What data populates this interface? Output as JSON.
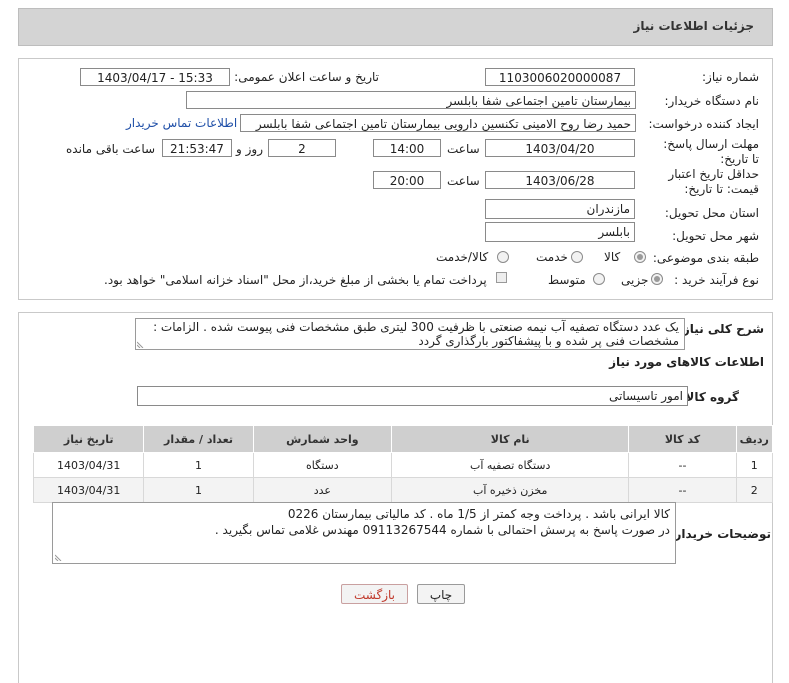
{
  "header": {
    "title": "جزئیات اطلاعات نیاز"
  },
  "form": {
    "need_number_label": "شماره نیاز:",
    "need_number": "1103006020000087",
    "announce_label": "تاریخ و ساعت اعلان عمومی:",
    "announce_value": "1403/04/17 - 15:33",
    "buyer_org_label": "نام دستگاه خریدار:",
    "buyer_org": "بیمارستان تامین اجتماعی شفا بابلسر",
    "requester_label": "ایجاد کننده درخواست:",
    "requester": "حمید رضا روح الامینی تکنسین دارویی بیمارستان تامین اجتماعی شفا بابلسر",
    "contact_link": "اطلاعات تماس خریدار",
    "deadline_label": "مهلت ارسال پاسخ: تا تاریخ:",
    "deadline_date": "1403/04/20",
    "time_label": "ساعت",
    "deadline_time": "14:00",
    "days": "2",
    "days_label": "روز و",
    "remaining_time": "21:53:47",
    "remaining_label": "ساعت باقی مانده",
    "validity_label": "حداقل تاریخ اعتبار قیمت: تا تاریخ:",
    "validity_date": "1403/06/28",
    "validity_time": "20:00",
    "province_label": "استان محل تحویل:",
    "province": "مازندران",
    "city_label": "شهر محل تحویل:",
    "city": "بابلسر",
    "category_label": "طبقه بندی موضوعی:",
    "category_options": [
      "کالا",
      "خدمت",
      "کالا/خدمت"
    ],
    "process_label": "نوع فرآیند خرید :",
    "process_options": [
      "جزیی",
      "متوسط"
    ],
    "payment_note": "پرداخت تمام یا بخشی از مبلغ خرید،از محل \"اسناد خزانه اسلامی\" خواهد بود."
  },
  "description": {
    "label": "شرح کلی نیاز:",
    "text": "یک عدد دستگاه تصفیه آب نیمه صنعتی با ظرفیت 300 لیتری طبق  مشخصات فنی پیوست شده . الزامات : مشخصات فنی پر شده و با پیشفاکتور بارگذاری گردد"
  },
  "goods_info": {
    "heading": "اطلاعات کالاهای مورد نیاز",
    "group_label": "گروه کالا:",
    "group_value": "امور تاسیساتی",
    "columns": [
      "ردیف",
      "کد کالا",
      "نام کالا",
      "واحد شمارش",
      "تعداد / مقدار",
      "تاریخ نیاز"
    ],
    "rows": [
      [
        "1",
        "--",
        "دستگاه تصفیه آب",
        "دستگاه",
        "1",
        "1403/04/31"
      ],
      [
        "2",
        "--",
        "مخزن ذخیره آب",
        "عدد",
        "1",
        "1403/04/31"
      ]
    ]
  },
  "buyer_notes": {
    "label": "توضیحات خریدار:",
    "line1": "کالا ایرانی باشد . پرداخت وجه کمتر از 1/5 ماه . کد مالیاتی بیمارستان 0226",
    "line2": "در صورت پاسخ به پرسش احتمالی با شماره 09113267544 مهندس غلامی تماس بگیرید ."
  },
  "buttons": {
    "print": "چاپ",
    "back": "بازگشت"
  },
  "colors": {
    "title_bg": "#d4d4d4",
    "table_header": "#cfcfcf",
    "link": "#1f4fa8",
    "back_text": "#c0392b"
  }
}
